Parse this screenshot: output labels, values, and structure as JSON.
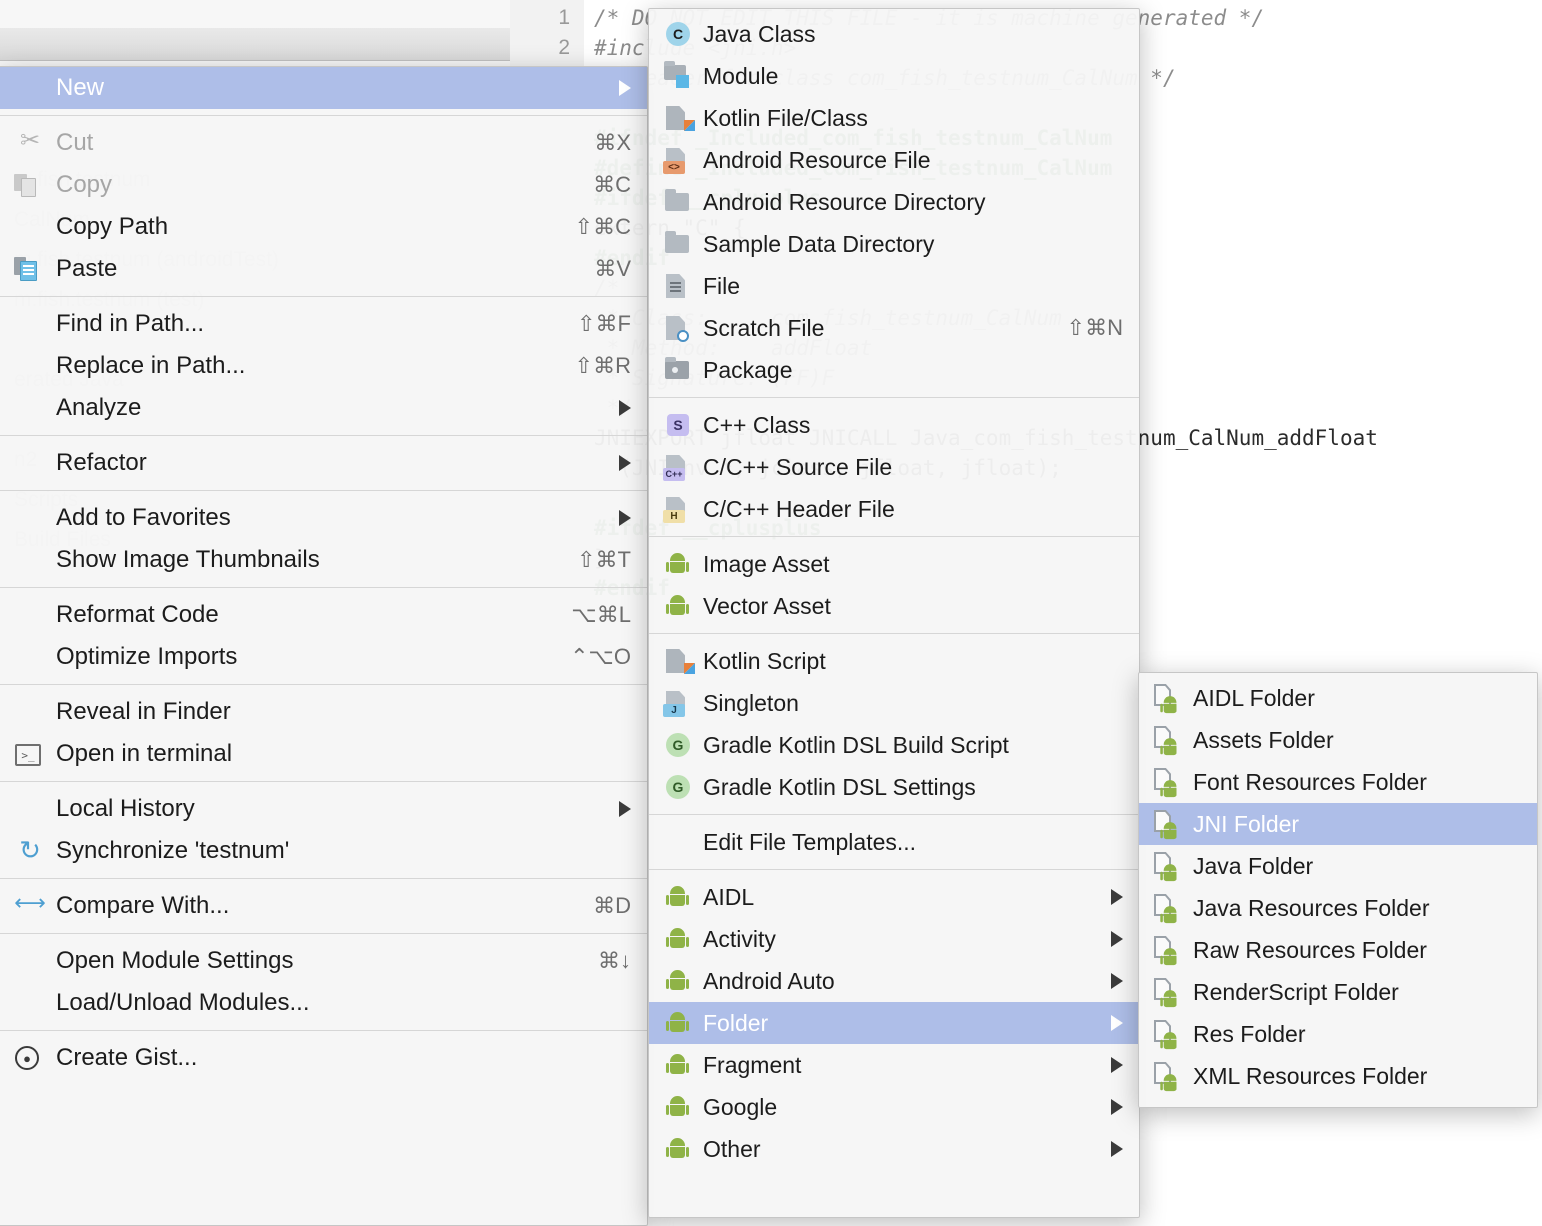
{
  "app": {
    "editor_tab_hidden": true,
    "gutter_lines": [
      "1",
      "2"
    ]
  },
  "background_editor": {
    "lines": [
      "/* DO NOT EDIT THIS FILE - it is machine generated */",
      "#include <jni.h>",
      "/* Header for class com_fish_testnum_CalNum */",
      "",
      "#ifndef _Included_com_fish_testnum_CalNum",
      "#define _Included_com_fish_testnum_CalNum",
      "#ifdef __cplusplus",
      "extern \"C\" {",
      "#endif",
      "/*",
      " * Class:     com_fish_testnum_CalNum",
      " * Method:    addFloat",
      " * Signature: (FF)F",
      " */",
      "JNIEXPORT jfloat JNICALL Java_com_fish_testnum_CalNum_addFloat",
      "  (JNIEnv *, jclass, jfloat, jfloat);",
      "",
      "#ifdef __cplusplus",
      "}",
      "#endif",
      "#endif"
    ]
  },
  "background_tree": {
    "items": [
      "testsu",
      "m.fish.testnum",
      "CalNum",
      "m.fish.testnum (androidTest)",
      "m.fish.testnum (test)",
      "erated Java",
      "n2",
      "Scripts",
      "Build Files"
    ]
  },
  "context_menu": {
    "name": "project-context-menu",
    "items": [
      {
        "label": "New",
        "icon": "none",
        "accel": "",
        "submenu": true,
        "selected": true,
        "disabled": false
      },
      {
        "type": "separator"
      },
      {
        "label": "Cut",
        "icon": "scissors-icon",
        "accel": "⌘X",
        "submenu": false,
        "disabled": true
      },
      {
        "label": "Copy",
        "icon": "copy-icon",
        "accel": "⌘C",
        "submenu": false,
        "disabled": true
      },
      {
        "label": "Copy Path",
        "icon": "none",
        "accel": "⇧⌘C",
        "submenu": false,
        "disabled": false
      },
      {
        "label": "Paste",
        "icon": "paste-icon",
        "accel": "⌘V",
        "submenu": false,
        "disabled": false
      },
      {
        "type": "separator"
      },
      {
        "label": "Find in Path...",
        "icon": "none",
        "accel": "⇧⌘F",
        "submenu": false,
        "disabled": false
      },
      {
        "label": "Replace in Path...",
        "icon": "none",
        "accel": "⇧⌘R",
        "submenu": false,
        "disabled": false
      },
      {
        "label": "Analyze",
        "icon": "none",
        "accel": "",
        "submenu": true,
        "disabled": false
      },
      {
        "type": "separator"
      },
      {
        "label": "Refactor",
        "icon": "none",
        "accel": "",
        "submenu": true,
        "disabled": false
      },
      {
        "type": "separator"
      },
      {
        "label": "Add to Favorites",
        "icon": "none",
        "accel": "",
        "submenu": true,
        "disabled": false
      },
      {
        "label": "Show Image Thumbnails",
        "icon": "none",
        "accel": "⇧⌘T",
        "submenu": false,
        "disabled": false
      },
      {
        "type": "separator"
      },
      {
        "label": "Reformat Code",
        "icon": "none",
        "accel": "⌥⌘L",
        "submenu": false,
        "disabled": false
      },
      {
        "label": "Optimize Imports",
        "icon": "none",
        "accel": "⌃⌥O",
        "submenu": false,
        "disabled": false
      },
      {
        "type": "separator"
      },
      {
        "label": "Reveal in Finder",
        "icon": "none",
        "accel": "",
        "submenu": false,
        "disabled": false
      },
      {
        "label": "Open in terminal",
        "icon": "terminal-icon",
        "accel": "",
        "submenu": false,
        "disabled": false
      },
      {
        "type": "separator"
      },
      {
        "label": "Local History",
        "icon": "none",
        "accel": "",
        "submenu": true,
        "disabled": false
      },
      {
        "label": "Synchronize 'testnum'",
        "icon": "sync-icon",
        "accel": "",
        "submenu": false,
        "disabled": false
      },
      {
        "type": "separator"
      },
      {
        "label": "Compare With...",
        "icon": "compare-icon",
        "accel": "⌘D",
        "submenu": false,
        "disabled": false
      },
      {
        "type": "separator"
      },
      {
        "label": "Open Module Settings",
        "icon": "none",
        "accel": "⌘↓",
        "submenu": false,
        "disabled": false
      },
      {
        "label": "Load/Unload Modules...",
        "icon": "none",
        "accel": "",
        "submenu": false,
        "disabled": false
      },
      {
        "type": "separator"
      },
      {
        "label": "Create Gist...",
        "icon": "github-icon",
        "accel": "",
        "submenu": false,
        "disabled": false
      }
    ]
  },
  "new_submenu": {
    "name": "new-submenu",
    "items": [
      {
        "label": "Java Class",
        "icon": "java-class-icon",
        "accel": "",
        "submenu": false
      },
      {
        "label": "Module",
        "icon": "module-icon",
        "accel": "",
        "submenu": false
      },
      {
        "label": "Kotlin File/Class",
        "icon": "kotlin-file-icon",
        "accel": "",
        "submenu": false
      },
      {
        "label": "Android Resource File",
        "icon": "android-resource-file-icon",
        "accel": "",
        "submenu": false
      },
      {
        "label": "Android Resource Directory",
        "icon": "folder-icon",
        "accel": "",
        "submenu": false
      },
      {
        "label": "Sample Data Directory",
        "icon": "folder-icon",
        "accel": "",
        "submenu": false
      },
      {
        "label": "File",
        "icon": "file-icon",
        "accel": "",
        "submenu": false
      },
      {
        "label": "Scratch File",
        "icon": "scratch-file-icon",
        "accel": "⇧⌘N",
        "submenu": false
      },
      {
        "label": "Package",
        "icon": "package-icon",
        "accel": "",
        "submenu": false
      },
      {
        "type": "separator"
      },
      {
        "label": "C++ Class",
        "icon": "cpp-class-icon",
        "accel": "",
        "submenu": false
      },
      {
        "label": "C/C++ Source File",
        "icon": "cpp-source-icon",
        "accel": "",
        "submenu": false
      },
      {
        "label": "C/C++ Header File",
        "icon": "cpp-header-icon",
        "accel": "",
        "submenu": false
      },
      {
        "type": "separator"
      },
      {
        "label": "Image Asset",
        "icon": "android-icon",
        "accel": "",
        "submenu": false
      },
      {
        "label": "Vector Asset",
        "icon": "android-icon",
        "accel": "",
        "submenu": false
      },
      {
        "type": "separator"
      },
      {
        "label": "Kotlin Script",
        "icon": "kotlin-script-icon",
        "accel": "",
        "submenu": false
      },
      {
        "label": "Singleton",
        "icon": "singleton-icon",
        "accel": "",
        "submenu": false
      },
      {
        "label": "Gradle Kotlin DSL Build Script",
        "icon": "gradle-icon",
        "accel": "",
        "submenu": false
      },
      {
        "label": "Gradle Kotlin DSL Settings",
        "icon": "gradle-icon",
        "accel": "",
        "submenu": false
      },
      {
        "type": "separator"
      },
      {
        "label": "Edit File Templates...",
        "icon": "none",
        "accel": "",
        "submenu": false
      },
      {
        "type": "separator"
      },
      {
        "label": "AIDL",
        "icon": "android-icon",
        "accel": "",
        "submenu": true
      },
      {
        "label": "Activity",
        "icon": "android-icon",
        "accel": "",
        "submenu": true
      },
      {
        "label": "Android Auto",
        "icon": "android-icon",
        "accel": "",
        "submenu": true
      },
      {
        "label": "Folder",
        "icon": "android-icon",
        "accel": "",
        "submenu": true,
        "selected": true
      },
      {
        "label": "Fragment",
        "icon": "android-icon",
        "accel": "",
        "submenu": true
      },
      {
        "label": "Google",
        "icon": "android-icon",
        "accel": "",
        "submenu": true
      },
      {
        "label": "Other",
        "icon": "android-icon",
        "accel": "",
        "submenu": true
      }
    ]
  },
  "folder_submenu": {
    "name": "folder-submenu",
    "items": [
      {
        "label": "AIDL Folder",
        "icon": "android-folder-icon",
        "selected": false
      },
      {
        "label": "Assets Folder",
        "icon": "android-folder-icon",
        "selected": false
      },
      {
        "label": "Font Resources Folder",
        "icon": "android-folder-icon",
        "selected": false
      },
      {
        "label": "JNI Folder",
        "icon": "android-folder-icon",
        "selected": true
      },
      {
        "label": "Java Folder",
        "icon": "android-folder-icon",
        "selected": false
      },
      {
        "label": "Java Resources Folder",
        "icon": "android-folder-icon",
        "selected": false
      },
      {
        "label": "Raw Resources Folder",
        "icon": "android-folder-icon",
        "selected": false
      },
      {
        "label": "RenderScript Folder",
        "icon": "android-folder-icon",
        "selected": false
      },
      {
        "label": "Res Folder",
        "icon": "android-folder-icon",
        "selected": false
      },
      {
        "label": "XML Resources Folder",
        "icon": "android-folder-icon",
        "selected": false
      }
    ]
  },
  "colors": {
    "selection": "#aebee8",
    "menu_bg": "#f6f6f6",
    "menu_border": "#c6c6c6",
    "accel_text": "#6e6e6e",
    "disabled_text": "#a6a6a6",
    "android_green": "#8fb347",
    "caret_line": "#fbf8e8"
  }
}
